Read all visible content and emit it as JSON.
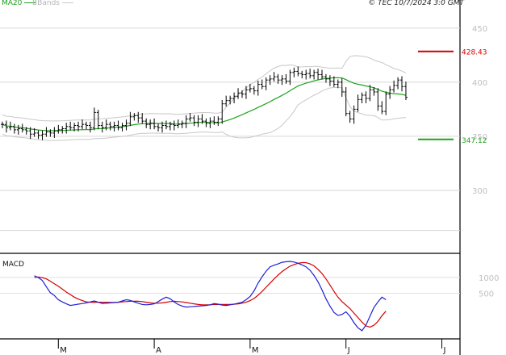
{
  "header": {
    "ma_label": "MA20",
    "bbands_label": "BBands",
    "timestamp": "© TEC 10/7/2024 3:0 GMT"
  },
  "colors": {
    "ma": "#1fa31f",
    "bbands": "#c8c8c8",
    "bars": "#000000",
    "resistance": "#d40000",
    "support": "#1fa31f",
    "macd": "#1f1fd6",
    "signal": "#d40000"
  },
  "chart_data": [
    {
      "type": "ohlc",
      "ylim": [
        250,
        470
      ],
      "yticks": [
        300,
        350,
        400,
        450
      ],
      "ytick_labels": [
        "300",
        "350",
        "400",
        "450"
      ],
      "xticks": [
        "M",
        "A",
        "M",
        "J",
        "J"
      ],
      "xtick_index": [
        14,
        38,
        62,
        86,
        110
      ],
      "levels": [
        {
          "name": "resistance",
          "value": 428.43,
          "label": "428.43"
        },
        {
          "name": "support",
          "value": 347.12,
          "label": "347.12"
        }
      ],
      "closes": [
        361,
        358,
        359,
        356,
        357,
        356,
        355,
        352,
        353,
        351,
        352,
        354,
        353,
        355,
        356,
        357,
        359,
        358,
        360,
        359,
        361,
        360,
        358,
        372,
        360,
        358,
        361,
        359,
        360,
        358,
        360,
        362,
        368,
        369,
        367,
        364,
        361,
        362,
        359,
        358,
        360,
        359,
        361,
        360,
        361,
        362,
        366,
        367,
        363,
        366,
        364,
        362,
        364,
        363,
        366,
        380,
        383,
        385,
        387,
        390,
        389,
        393,
        394,
        392,
        398,
        396,
        402,
        403,
        405,
        402,
        403,
        401,
        409,
        410,
        408,
        407,
        408,
        406,
        409,
        407,
        405,
        403,
        401,
        398,
        400,
        391,
        371,
        366,
        375,
        384,
        388,
        385,
        393,
        391,
        378,
        373,
        389,
        393,
        397,
        402,
        396,
        386
      ]
    },
    {
      "type": "line",
      "title": "MACD",
      "ylim": [
        -800,
        1600
      ],
      "yticks": [
        500,
        1000
      ],
      "ytick_labels": [
        "500",
        "1000"
      ],
      "series": [
        {
          "name": "macd",
          "values": [
            1050,
            990,
            900,
            700,
            520,
            430,
            300,
            230,
            170,
            120,
            140,
            160,
            180,
            200,
            230,
            260,
            220,
            180,
            190,
            200,
            210,
            220,
            260,
            300,
            280,
            230,
            190,
            150,
            140,
            150,
            170,
            240,
            320,
            380,
            330,
            230,
            150,
            100,
            70,
            80,
            90,
            100,
            110,
            120,
            140,
            180,
            160,
            130,
            120,
            140,
            160,
            190,
            220,
            300,
            400,
            580,
            820,
            1020,
            1190,
            1330,
            1380,
            1420,
            1470,
            1490,
            1500,
            1480,
            1440,
            1390,
            1330,
            1220,
            1060,
            860,
            610,
            330,
            100,
            -100,
            -190,
            -160,
            -80,
            -220,
            -420,
            -580,
            -670,
            -500,
            -220,
            60,
            230,
            380,
            300
          ]
        },
        {
          "name": "signal",
          "values": [
            1000,
            1010,
            990,
            950,
            880,
            800,
            720,
            630,
            540,
            460,
            380,
            320,
            270,
            230,
            220,
            220,
            220,
            220,
            220,
            215,
            215,
            220,
            230,
            240,
            250,
            250,
            250,
            240,
            220,
            200,
            190,
            190,
            200,
            220,
            240,
            250,
            240,
            230,
            210,
            190,
            170,
            150,
            140,
            140,
            140,
            150,
            150,
            150,
            150,
            150,
            160,
            170,
            190,
            220,
            270,
            340,
            440,
            560,
            690,
            820,
            950,
            1070,
            1180,
            1270,
            1350,
            1400,
            1440,
            1460,
            1460,
            1420,
            1360,
            1250,
            1120,
            950,
            760,
            560,
            380,
            240,
            130,
            20,
            -120,
            -260,
            -400,
            -520,
            -560,
            -500,
            -380,
            -200,
            -60
          ]
        }
      ]
    }
  ]
}
